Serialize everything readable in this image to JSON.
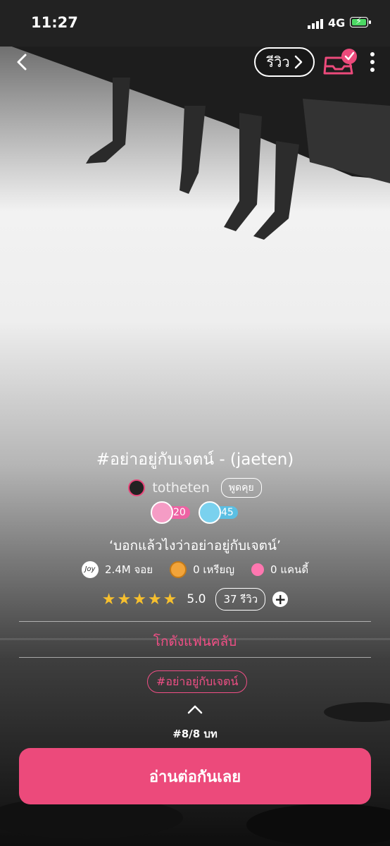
{
  "status_bar": {
    "time": "11:27",
    "network": "4G"
  },
  "nav": {
    "review_label": "รีวิว"
  },
  "novel": {
    "title": "#อย่าอยู่กับเจตน์ - (jaeten)",
    "author": "totheten",
    "chat_label": "พูดคุย",
    "badges": [
      {
        "value": "20"
      },
      {
        "value": "45"
      }
    ],
    "tagline": "‘บอกแล้วไงว่าอย่าอยู่กับเจตน์’",
    "stats": {
      "joy_icon_text": "Joy",
      "joy": "2.4M จอย",
      "coins": "0 เหรียญ",
      "candy": "0 แคนดี้"
    },
    "stars": "★★★★★",
    "rating": "5.0",
    "review_count": "37 รีวิว",
    "add_symbol": "+"
  },
  "fanclub_label": "โกดังแฟนคลับ",
  "tag": "#อย่าอยู่กับเจตน์",
  "episode": "#8/8 บท",
  "read_button": "อ่านต่อกันเลย",
  "colors": {
    "accent": "#ec4a7b",
    "star": "#f7c02e"
  },
  "icons": [
    "back-icon",
    "chevron-right-icon",
    "shelf-check-icon",
    "more-icon",
    "joy-icon",
    "coin-icon",
    "candy-icon",
    "chevron-up-icon"
  ]
}
